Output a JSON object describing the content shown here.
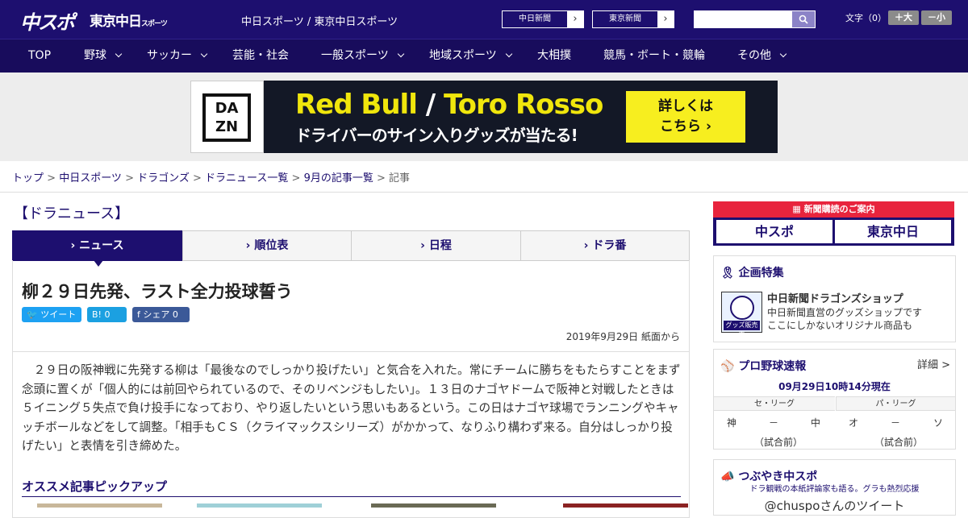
{
  "header": {
    "logo_main": "中スポ",
    "logo_sub": "東京中日",
    "logo_sub_small": "スポーツ",
    "tagline": "中日スポーツ / 東京中日スポーツ",
    "links": [
      {
        "label": "中日新聞"
      },
      {
        "label": "東京新聞"
      }
    ],
    "search_placeholder": "",
    "font_size_label": "文字（0）",
    "font_up": "＋大",
    "font_down": "－小"
  },
  "nav": [
    {
      "label": "TOP"
    },
    {
      "label": "野球"
    },
    {
      "label": "サッカー"
    },
    {
      "label": "芸能・社会"
    },
    {
      "label": "一般スポーツ"
    },
    {
      "label": "地域スポーツ"
    },
    {
      "label": "大相撲"
    },
    {
      "label": "競馬・ボート・競輪"
    },
    {
      "label": "その他"
    }
  ],
  "ad": {
    "brand": "DAZN",
    "brand_line1": "DA",
    "brand_line2": "ZN",
    "title_a": "Red Bull",
    "title_sep": "/",
    "title_b": "Toro Rosso",
    "subtitle": "ドライバーのサイン入りグッズが当たる!",
    "cta_line1": "詳しくは",
    "cta_line2": "こちら ›"
  },
  "breadcrumb": {
    "items": [
      "トップ",
      "中日スポーツ",
      "ドラゴンズ",
      "ドラニュース一覧",
      "9月の記事一覧"
    ],
    "current": "記事",
    "sep": " > "
  },
  "section_title": "【ドラニュース】",
  "tabs": [
    {
      "label": "› ニュース"
    },
    {
      "label": "› 順位表"
    },
    {
      "label": "› 日程"
    },
    {
      "label": "› ドラ番"
    }
  ],
  "article": {
    "headline": "柳２９日先発、ラスト全力投球誓う",
    "share_tweet": "ツイート",
    "share_hatena": "B! 0",
    "share_fb": "f シェア 0",
    "date": "2019年9月29日 紙面から",
    "body": "２９日の阪神戦に先発する柳は「最後なのでしっかり投げたい」と気合を入れた。常にチームに勝ちをもたらすことをまず念頭に置くが「個人的には前回やられているので、そのリベンジもしたい」。１３日のナゴヤドームで阪神と対戦したときは５イニング５失点で負け投手になっており、やり返したいという思いもあるという。この日はナゴヤ球場でランニングやキャッチボールなどをして調整。「相手もＣＳ（クライマックスシリーズ）がかかって、なりふり構わず来る。自分はしっかり投げたい」と表情を引き締めた。",
    "pickup_title": "オススメ記事ピックアップ"
  },
  "sidebar": {
    "subscribe_head": "新聞購読のご案内",
    "subscribe_a": "中スポ",
    "subscribe_b": "東京中日",
    "tokushu_title": "企画特集",
    "shop_img_label": "グッズ販売中",
    "shop_name": "中日新聞ドラゴンズショップ",
    "shop_desc1": "中日新聞直営のグッズショップです",
    "shop_desc2": "ここにしかないオリジナル商品も",
    "scores_title": "プロ野球速報",
    "scores_more": "詳細 >",
    "scores_asof": "09月29日10時14分現在",
    "leagues": [
      {
        "name": "セ・リーグ",
        "home": "神",
        "sep": "－",
        "away": "中",
        "status": "（試合前）"
      },
      {
        "name": "パ・リーグ",
        "home": "オ",
        "sep": "－",
        "away": "ソ",
        "status": "（試合前）"
      }
    ],
    "tweet_title": "つぶやき中スポ",
    "tweet_sub": "ドラ観戦の本紙評論家も語る。グラも熱烈応援",
    "tweet_account": "@chuspoさんのツイート"
  },
  "colors": {
    "brand": "#1d0f6f",
    "nav": "#180c5c",
    "ad_yellow": "#f7ee1f",
    "subscribe_red": "#e8243d"
  }
}
